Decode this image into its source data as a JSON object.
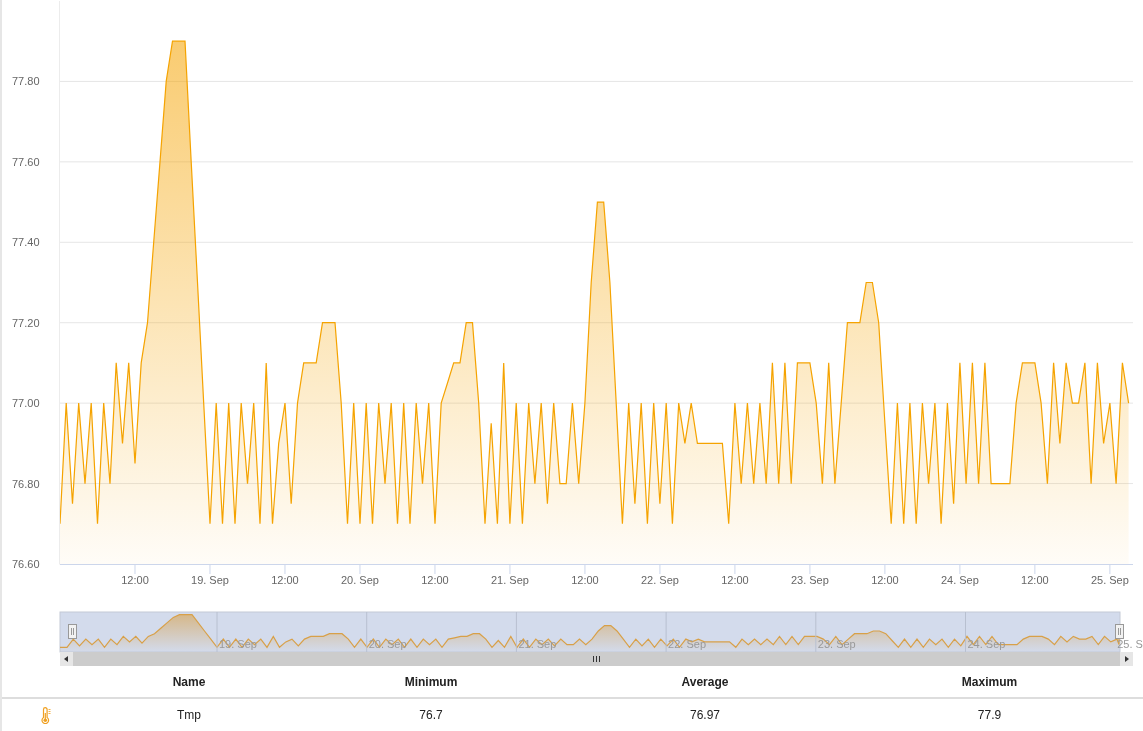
{
  "chart": {
    "chart_data": {
      "type": "area",
      "grid": true,
      "ylim": [
        76.6,
        78.0
      ],
      "yticks": [
        {
          "value": 76.6,
          "label": "76.60"
        },
        {
          "value": 76.8,
          "label": "76.80"
        },
        {
          "value": 77.0,
          "label": "77.00"
        },
        {
          "value": 77.2,
          "label": "77.20"
        },
        {
          "value": 77.4,
          "label": "77.40"
        },
        {
          "value": 77.6,
          "label": "77.60"
        },
        {
          "value": 77.8,
          "label": "77.80"
        }
      ],
      "categories": [
        null,
        null,
        null,
        null,
        null,
        null,
        null,
        null,
        null,
        null,
        null,
        null,
        "12:00",
        null,
        null,
        null,
        null,
        null,
        null,
        null,
        null,
        null,
        null,
        null,
        "19. Sep",
        null,
        null,
        null,
        null,
        null,
        null,
        null,
        null,
        null,
        null,
        null,
        "12:00",
        null,
        null,
        null,
        null,
        null,
        null,
        null,
        null,
        null,
        null,
        null,
        "20. Sep",
        null,
        null,
        null,
        null,
        null,
        null,
        null,
        null,
        null,
        null,
        null,
        "12:00",
        null,
        null,
        null,
        null,
        null,
        null,
        null,
        null,
        null,
        null,
        null,
        "21. Sep",
        null,
        null,
        null,
        null,
        null,
        null,
        null,
        null,
        null,
        null,
        null,
        "12:00",
        null,
        null,
        null,
        null,
        null,
        null,
        null,
        null,
        null,
        null,
        null,
        "22. Sep",
        null,
        null,
        null,
        null,
        null,
        null,
        null,
        null,
        null,
        null,
        null,
        "12:00",
        null,
        null,
        null,
        null,
        null,
        null,
        null,
        null,
        null,
        null,
        null,
        "23. Sep",
        null,
        null,
        null,
        null,
        null,
        null,
        null,
        null,
        null,
        null,
        null,
        "12:00",
        null,
        null,
        null,
        null,
        null,
        null,
        null,
        null,
        null,
        null,
        null,
        "24. Sep",
        null,
        null,
        null,
        null,
        null,
        null,
        null,
        null,
        null,
        null,
        null,
        "12:00",
        null,
        null,
        null,
        null,
        null,
        null,
        null,
        null,
        null,
        null,
        null,
        "25. Sep",
        null,
        null,
        null
      ],
      "series": [
        {
          "color": "#f5a300",
          "values": [
            76.7,
            77.0,
            76.75,
            77.0,
            76.8,
            77.0,
            76.7,
            77.0,
            76.8,
            77.1,
            76.9,
            77.1,
            76.85,
            77.1,
            77.2,
            77.4,
            77.6,
            77.8,
            77.9,
            77.9,
            77.9,
            77.6,
            77.3,
            77.0,
            76.7,
            77.0,
            76.7,
            77.0,
            76.7,
            77.0,
            76.8,
            77.0,
            76.7,
            77.1,
            76.7,
            76.9,
            77.0,
            76.75,
            77.0,
            77.1,
            77.1,
            77.1,
            77.2,
            77.2,
            77.2,
            77.0,
            76.7,
            77.0,
            76.7,
            77.0,
            76.7,
            77.0,
            76.8,
            77.0,
            76.7,
            77.0,
            76.7,
            77.0,
            76.8,
            77.0,
            76.7,
            77.0,
            77.05,
            77.1,
            77.1,
            77.2,
            77.2,
            77.0,
            76.7,
            76.95,
            76.7,
            77.1,
            76.7,
            77.0,
            76.7,
            77.0,
            76.8,
            77.0,
            76.75,
            77.0,
            76.8,
            76.8,
            77.0,
            76.8,
            77.0,
            77.3,
            77.5,
            77.5,
            77.3,
            77.0,
            76.7,
            77.0,
            76.75,
            77.0,
            76.7,
            77.0,
            76.75,
            77.0,
            76.7,
            77.0,
            76.9,
            77.0,
            76.9,
            76.9,
            76.9,
            76.9,
            76.9,
            76.7,
            77.0,
            76.8,
            77.0,
            76.8,
            77.0,
            76.8,
            77.1,
            76.8,
            77.1,
            76.8,
            77.1,
            77.1,
            77.1,
            77.0,
            76.8,
            77.1,
            76.8,
            77.0,
            77.2,
            77.2,
            77.2,
            77.3,
            77.3,
            77.2,
            76.95,
            76.7,
            77.0,
            76.7,
            77.0,
            76.7,
            77.0,
            76.8,
            77.0,
            76.7,
            77.0,
            76.75,
            77.1,
            76.8,
            77.1,
            76.8,
            77.1,
            76.8,
            76.8,
            76.8,
            76.8,
            77.0,
            77.1,
            77.1,
            77.1,
            77.0,
            76.8,
            77.1,
            76.9,
            77.1,
            77.0,
            77.0,
            77.1,
            76.8,
            77.1,
            76.9,
            77.0,
            76.8,
            77.1,
            77.0
          ]
        }
      ]
    }
  },
  "navigator": {
    "labels": [
      "19. Sep",
      "20. Sep",
      "21. Sep",
      "22. Sep",
      "23. Sep",
      "24. Sep",
      "25. S"
    ]
  },
  "table": {
    "columns": [
      "Name",
      "Minimum",
      "Average",
      "Maximum"
    ],
    "rows": [
      {
        "cells": [
          "Tmp",
          "76.7",
          "76.97",
          "77.9"
        ]
      }
    ]
  }
}
